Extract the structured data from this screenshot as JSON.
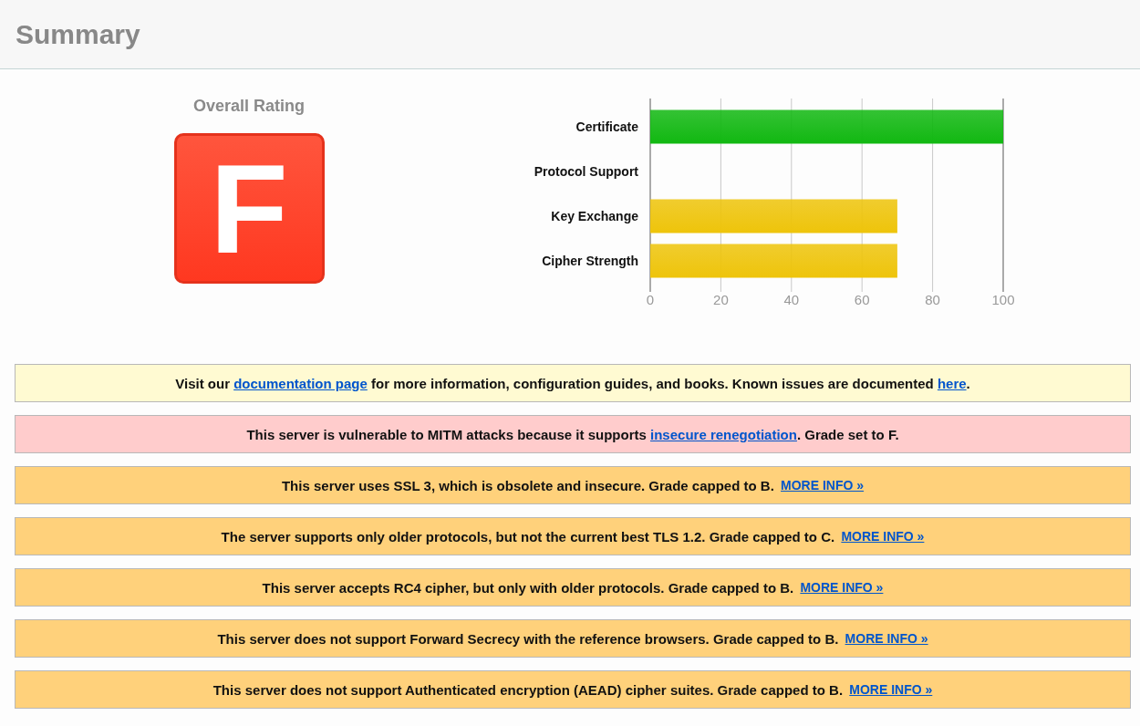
{
  "header": {
    "title": "Summary"
  },
  "rating": {
    "label": "Overall Rating",
    "grade": "F"
  },
  "chart_data": {
    "type": "bar",
    "orientation": "horizontal",
    "grid": true,
    "categories": [
      "Certificate",
      "Protocol Support",
      "Key Exchange",
      "Cipher Strength"
    ],
    "series": [
      {
        "color": "#11b811",
        "values": [
          100,
          null,
          null,
          null
        ]
      },
      {
        "color": "#eec40a",
        "values": [
          null,
          0,
          70,
          70
        ]
      }
    ],
    "xlim": [
      0,
      100
    ],
    "xticks": [
      0,
      20,
      40,
      60,
      80,
      100
    ]
  },
  "notices": [
    {
      "kind": "info",
      "parts": [
        {
          "kind": "text",
          "text": "Visit our "
        },
        {
          "kind": "link",
          "text": "documentation page"
        },
        {
          "kind": "text",
          "text": " for more information, configuration guides, and books. Known issues are documented "
        },
        {
          "kind": "link",
          "text": "here"
        },
        {
          "kind": "text",
          "text": "."
        }
      ]
    },
    {
      "kind": "error",
      "parts": [
        {
          "kind": "text",
          "text": "This server is vulnerable to MITM attacks because it supports "
        },
        {
          "kind": "link",
          "text": "insecure renegotiation"
        },
        {
          "kind": "text",
          "text": ". Grade set to F."
        }
      ]
    },
    {
      "kind": "warning",
      "parts": [
        {
          "kind": "text",
          "text": "This server uses SSL 3, which is obsolete and insecure. Grade capped to B. "
        },
        {
          "kind": "more",
          "text": "MORE INFO »"
        }
      ]
    },
    {
      "kind": "warning",
      "parts": [
        {
          "kind": "text",
          "text": "The server supports only older protocols, but not the current best TLS 1.2. Grade capped to C. "
        },
        {
          "kind": "more",
          "text": "MORE INFO »"
        }
      ]
    },
    {
      "kind": "warning",
      "parts": [
        {
          "kind": "text",
          "text": "This server accepts RC4 cipher, but only with older protocols. Grade capped to B. "
        },
        {
          "kind": "more",
          "text": "MORE INFO »"
        }
      ]
    },
    {
      "kind": "warning",
      "parts": [
        {
          "kind": "text",
          "text": "This server does not support Forward Secrecy with the reference browsers. Grade capped to B. "
        },
        {
          "kind": "more",
          "text": "MORE INFO »"
        }
      ]
    },
    {
      "kind": "warning",
      "parts": [
        {
          "kind": "text",
          "text": "This server does not support Authenticated encryption (AEAD) cipher suites. Grade capped to B. "
        },
        {
          "kind": "more",
          "text": "MORE INFO »"
        }
      ]
    }
  ]
}
